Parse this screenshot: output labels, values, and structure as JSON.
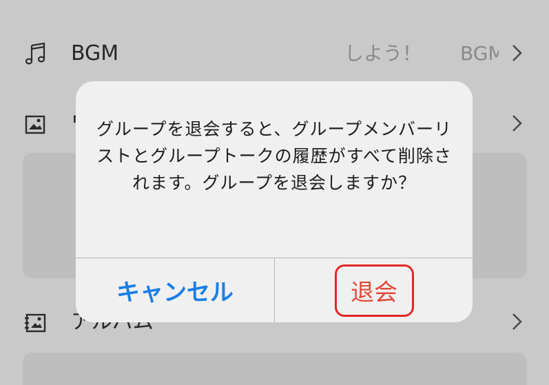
{
  "settings": {
    "rows": [
      {
        "label": "BGM",
        "value": "しよう！",
        "value2": "BGM",
        "icon": "music-note-icon"
      },
      {
        "label": "ワ",
        "icon": "image-icon"
      },
      {
        "label": "アルバム",
        "icon": "album-icon"
      }
    ]
  },
  "dialog": {
    "message": "グループを退会すると、グループメンバーリストとグループトークの履歴がすべて削除されます。グループを退会しますか？",
    "cancel_label": "キャンセル",
    "leave_label": "退会"
  },
  "colors": {
    "cancel": "#1a7ee6",
    "destructive": "#e24a3a",
    "highlight": "#e32525"
  }
}
